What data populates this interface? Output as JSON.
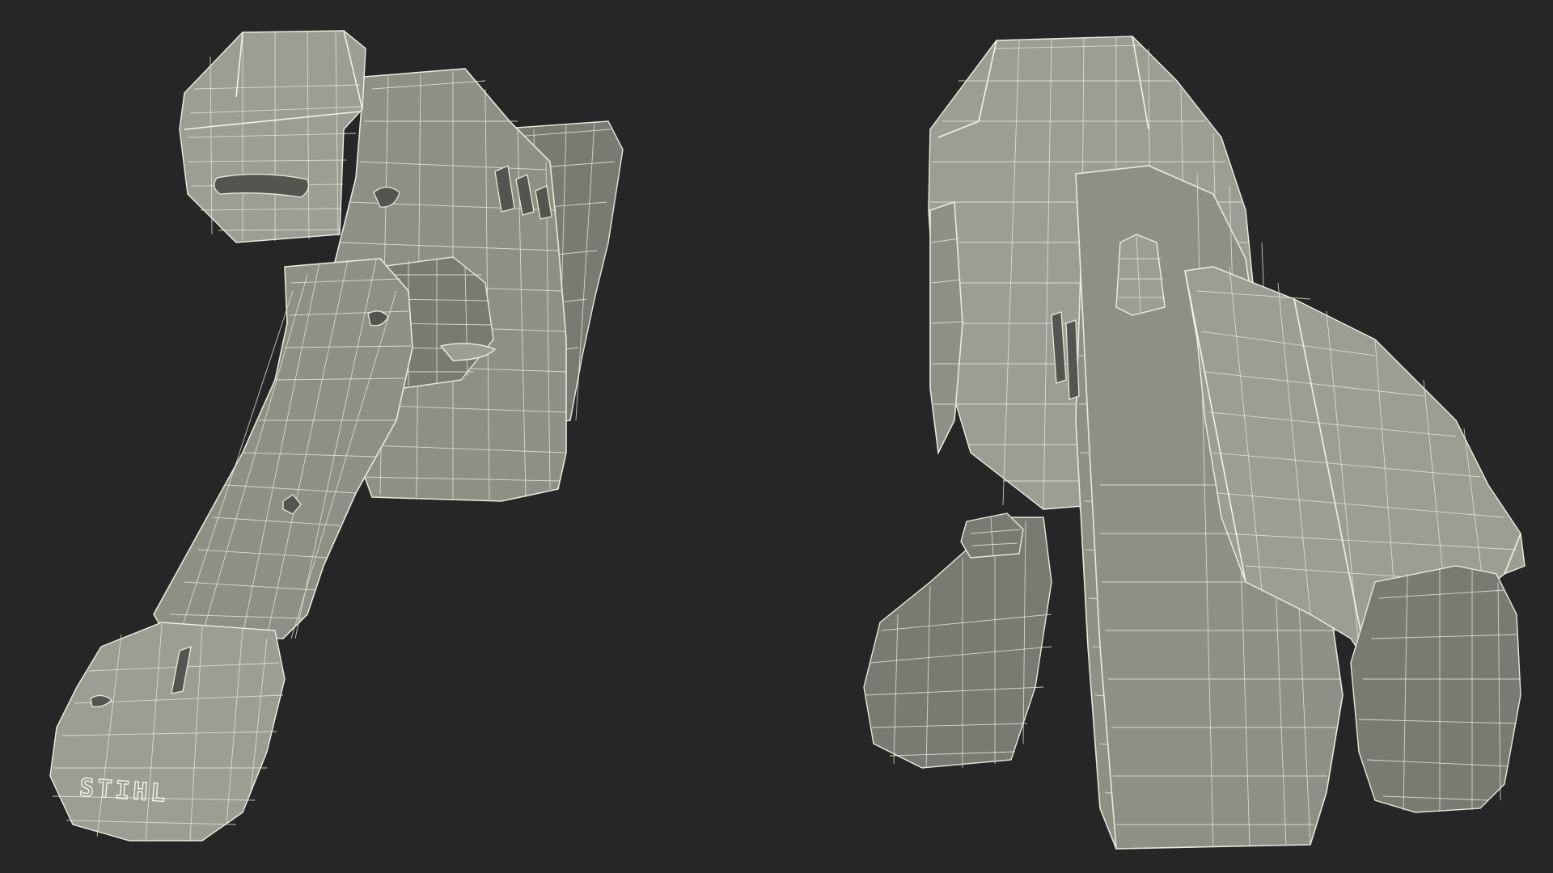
{
  "scene": {
    "background": "#262626",
    "model_fill": "#8f8f86",
    "wire_color": "#e8e8dc"
  },
  "left_view": {
    "logo_text": "STIHL"
  }
}
